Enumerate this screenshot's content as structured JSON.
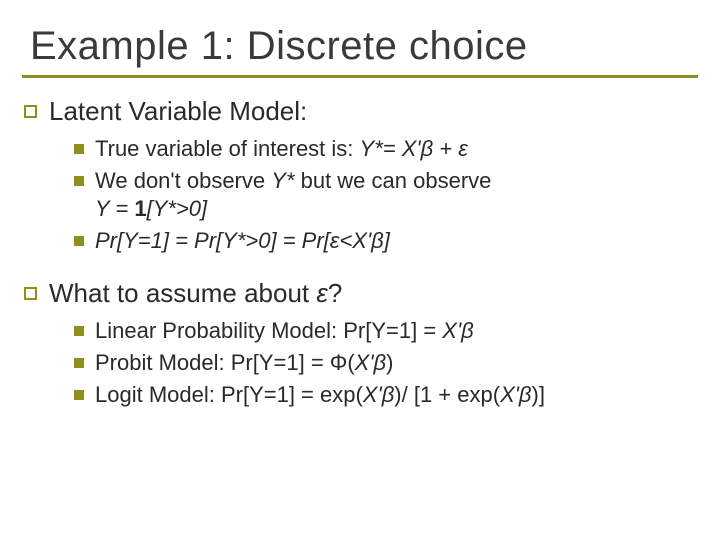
{
  "title": "Example 1: Discrete choice",
  "section1": {
    "heading": "Latent Variable Model:",
    "items": [
      {
        "pre": "True variable of interest is: ",
        "math": "Y*= X'β + ε"
      },
      {
        "pre": "We don't observe ",
        "mid_i": "Y*",
        "mid_t": " but we can observe",
        "cont_pre": "Y = ",
        "cont_bold": "1",
        "cont_post": "[Y*>0]"
      },
      {
        "text": "Pr[Y=1] = Pr[Y*>0] = Pr[ε<X'β]"
      }
    ]
  },
  "section2": {
    "heading_pre": "What to assume about ",
    "heading_i": "ε",
    "heading_post": "?",
    "items": [
      {
        "label": " Linear Probability Model: Pr[Y=1] = ",
        "math": "X'β"
      },
      {
        "label": "Probit Model: Pr[Y=1] = Φ(",
        "math": "X'β",
        "post": ")"
      },
      {
        "label": "Logit Model: Pr[Y=1]  = exp(",
        "math1": "X'β",
        "mid": ")/ [1 + exp(",
        "math2": "X'β",
        "post": ")]"
      }
    ]
  }
}
